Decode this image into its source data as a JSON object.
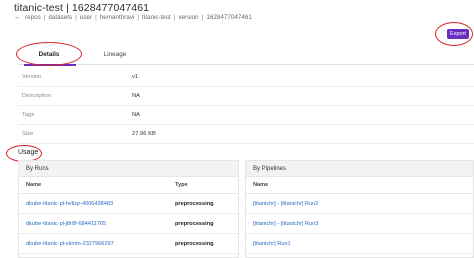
{
  "header": {
    "title": "titanic-test | 1628477047461",
    "breadcrumb": [
      "repos",
      "datasets",
      "user",
      "hemanthravi",
      "titanic-test",
      "version",
      "1628477047461"
    ],
    "export_label": "Export"
  },
  "tabs": [
    {
      "label": "Details",
      "active": true
    },
    {
      "label": "Lineage",
      "active": false
    }
  ],
  "properties": [
    {
      "label": "Version",
      "value": "v1"
    },
    {
      "label": "Description",
      "value": "NA"
    },
    {
      "label": "Tags",
      "value": "NA"
    },
    {
      "label": "Size",
      "value": "27.96 KB"
    }
  ],
  "usage": {
    "title": "Usage",
    "runs": {
      "title": "By Runs",
      "columns": [
        "Name",
        "Type"
      ],
      "rows": [
        {
          "name": "dkube-titanic-pl-hvllzp-4006438483",
          "type": "preprocessing"
        },
        {
          "name": "dkube-titanic-pl-j8r8f-684411765",
          "type": "preprocessing"
        },
        {
          "name": "dkube-titanic-pl-xkmtn-2327966297",
          "type": "preprocessing"
        }
      ]
    },
    "pipelines": {
      "title": "By Pipelines",
      "columns": [
        "Name"
      ],
      "rows": [
        {
          "name": "[titanichr] - [titanichr] Run2"
        },
        {
          "name": "[titanichr] - [titanichr] Run3"
        },
        {
          "name": "[titanichr] Run1"
        }
      ]
    }
  },
  "colors": {
    "accent": "#6a2dbf",
    "link": "#2b6cc4",
    "annotation": "#d9252a"
  }
}
